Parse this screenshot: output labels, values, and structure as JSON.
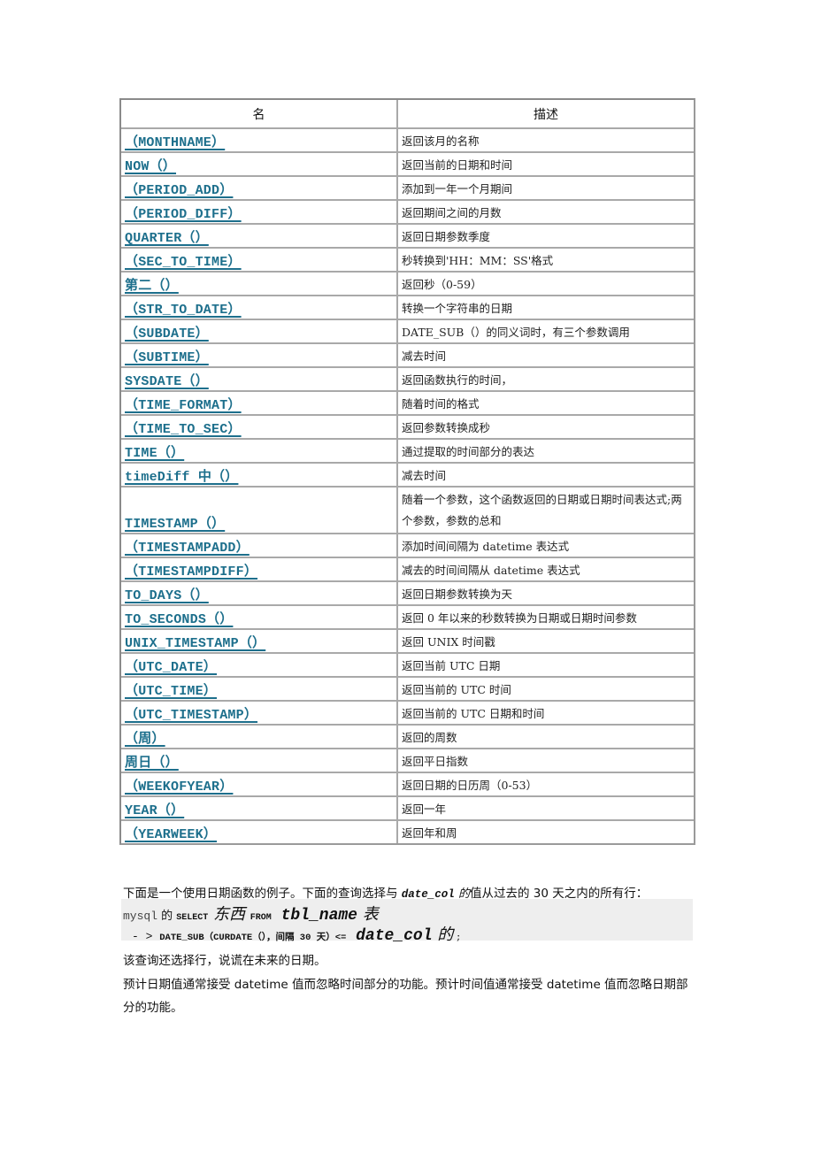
{
  "table": {
    "headers": {
      "name": "名",
      "description": "描述"
    },
    "link_color": "#1d6f8c",
    "rows": [
      {
        "name": "（MONTHNAME）",
        "desc": "返回该月的名称"
      },
      {
        "name": "NOW（）",
        "desc": "返回当前的日期和时间"
      },
      {
        "name": "（PERIOD_ADD）",
        "desc": "添加到一年一个月期间"
      },
      {
        "name": "（PERIOD_DIFF）",
        "desc": "返回期间之间的月数"
      },
      {
        "name": "QUARTER（）",
        "desc": "返回日期参数季度"
      },
      {
        "name": "（SEC_TO_TIME）",
        "desc": "秒转换到'HH：MM：SS'格式"
      },
      {
        "name": "第二（）",
        "desc": "返回秒（0-59）"
      },
      {
        "name": "（STR_TO_DATE）",
        "desc": "转换一个字符串的日期"
      },
      {
        "name": "（SUBDATE）",
        "desc": "DATE_SUB（）的同义词时，有三个参数调用"
      },
      {
        "name": "（SUBTIME）",
        "desc": "减去时间"
      },
      {
        "name": "SYSDATE（）",
        "desc": "返回函数执行的时间，"
      },
      {
        "name": "（TIME_FORMAT）",
        "desc": "随着时间的格式"
      },
      {
        "name": "（TIME_TO_SEC）",
        "desc": "返回参数转换成秒"
      },
      {
        "name": "TIME（）",
        "desc": "通过提取的时间部分的表达"
      },
      {
        "name": "timeDiff 中（）",
        "desc": "减去时间"
      },
      {
        "name": "TIMESTAMP（）",
        "desc": "随着一个参数，这个函数返回的日期或日期时间表达式;两个参数，参数的总和",
        "tall": true
      },
      {
        "name": "（TIMESTAMPADD）",
        "desc": "添加时间间隔为 datetime 表达式"
      },
      {
        "name": "（TIMESTAMPDIFF）",
        "desc": "减去的时间间隔从 datetime 表达式"
      },
      {
        "name": "TO_DAYS（）",
        "desc": "返回日期参数转换为天"
      },
      {
        "name": "TO_SECONDS（）",
        "desc": "返回 0 年以来的秒数转换为日期或日期时间参数"
      },
      {
        "name": "UNIX_TIMESTAMP（）",
        "desc": "返回 UNIX 时间戳"
      },
      {
        "name": "（UTC_DATE）",
        "desc": "返回当前 UTC 日期"
      },
      {
        "name": "（UTC_TIME）",
        "desc": "返回当前的 UTC 时间"
      },
      {
        "name": "（UTC_TIMESTAMP）",
        "desc": "返回当前的 UTC 日期和时间"
      },
      {
        "name": "（周）",
        "desc": "返回的周数"
      },
      {
        "name": "周日（）",
        "desc": "返回平日指数"
      },
      {
        "name": "（WEEKOFYEAR）",
        "desc": "返回日期的日历周（0-53）"
      },
      {
        "name": "YEAR（）",
        "desc": "返回一年"
      },
      {
        "name": "（YEARWEEK）",
        "desc": "返回年和周"
      }
    ]
  },
  "intro": {
    "before": "下面是一个使用日期函数的例子。下面的查询选择与 ",
    "code": "date_col",
    "code_suffix": " 的",
    "after": "值从过去的 30 天之内的所有行："
  },
  "code": {
    "line1": {
      "prompt": "mysql",
      "de": " 的 ",
      "select": "SELECT",
      "thing": " 东西 ",
      "from": "FROM",
      "table": " tbl_name",
      "table_cn": " 表"
    },
    "line2": {
      "arrow": "- > ",
      "expr": "DATE_SUB（CURDATE（），间隔 30 天）<=",
      "col": " date_col",
      "col_cn": " 的",
      "end": " ;"
    },
    "background": "#eeeeee"
  },
  "paragraphs": {
    "p2": "该查询还选择行，说谎在未来的日期。",
    "p3": "预计日期值通常接受 datetime 值而忽略时间部分的功能。预计时间值通常接受 datetime 值而忽略日期部分的功能。"
  }
}
